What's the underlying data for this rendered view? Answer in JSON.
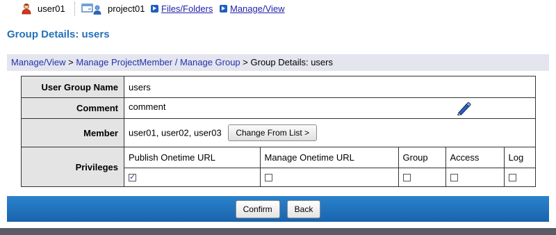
{
  "topbar": {
    "user": "user01",
    "project": "project01",
    "files_link": "Files/Folders",
    "manage_link": "Manage/View"
  },
  "page_title": "Group Details: users",
  "breadcrumb": {
    "item1": "Manage/View",
    "sep1": " > ",
    "item2": "Manage ProjectMember / Manage Group",
    "sep2": " > ",
    "current": "Group Details: users"
  },
  "details": {
    "group_name_label": "User Group Name",
    "group_name_value": "users",
    "comment_label": "Comment",
    "comment_value": "comment",
    "member_label": "Member",
    "member_value": "user01, user02, user03",
    "change_button": "Change From List >",
    "privileges_label": "Privileges",
    "privileges": [
      {
        "label": "Publish Onetime URL",
        "checked": true
      },
      {
        "label": "Manage Onetime URL",
        "checked": false
      },
      {
        "label": "Group",
        "checked": false
      },
      {
        "label": "Access",
        "checked": false
      },
      {
        "label": "Log",
        "checked": false
      }
    ]
  },
  "footer": {
    "confirm": "Confirm",
    "back": "Back"
  },
  "colors": {
    "title": "#2272b6",
    "breadcrumb_bg": "#e4e5ee",
    "footer_bar": "#1f6fbc",
    "label_bg": "#e4e4e4"
  },
  "icons": {
    "user": "user-icon",
    "project": "project-icon",
    "edit": "pencil-icon",
    "link_arrow": "arrow-right-icon"
  }
}
